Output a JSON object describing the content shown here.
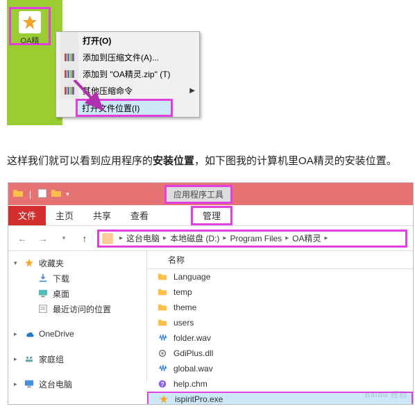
{
  "shortcut": {
    "label": "OA精"
  },
  "context_menu": {
    "open": "打开(O)",
    "add_archive": "添加到压缩文件(A)...",
    "add_zip": "添加到 \"OA精灵.zip\" (T)",
    "other": "其他压缩命令",
    "open_location": "打开文件位置(I)"
  },
  "description": {
    "pre": "这样我们就可以看到应用程序的",
    "strong": "安装位置",
    "post": "，如下图我的计算机里OA精灵的安装位置。"
  },
  "explorer": {
    "context_header": "应用程序工具",
    "tabs": {
      "file": "文件",
      "home": "主页",
      "share": "共享",
      "view": "查看",
      "manage": "管理"
    },
    "breadcrumb": [
      "这台电脑",
      "本地磁盘 (D:)",
      "Program Files",
      "OA精灵"
    ],
    "nav": {
      "favorites": "收藏夹",
      "downloads": "下载",
      "desktop": "桌面",
      "recent": "最近访问的位置",
      "onedrive": "OneDrive",
      "homegroup": "家庭组",
      "thispc": "这台电脑"
    },
    "col_name": "名称",
    "files": [
      {
        "name": "Language",
        "type": "folder"
      },
      {
        "name": "temp",
        "type": "folder"
      },
      {
        "name": "theme",
        "type": "folder"
      },
      {
        "name": "users",
        "type": "folder"
      },
      {
        "name": "folder.wav",
        "type": "wav"
      },
      {
        "name": "GdiPlus.dll",
        "type": "dll"
      },
      {
        "name": "global.wav",
        "type": "wav"
      },
      {
        "name": "help.chm",
        "type": "chm"
      },
      {
        "name": "ispiritPro.exe",
        "type": "exe",
        "selected": true
      }
    ]
  },
  "watermark": "Baidu 经验"
}
